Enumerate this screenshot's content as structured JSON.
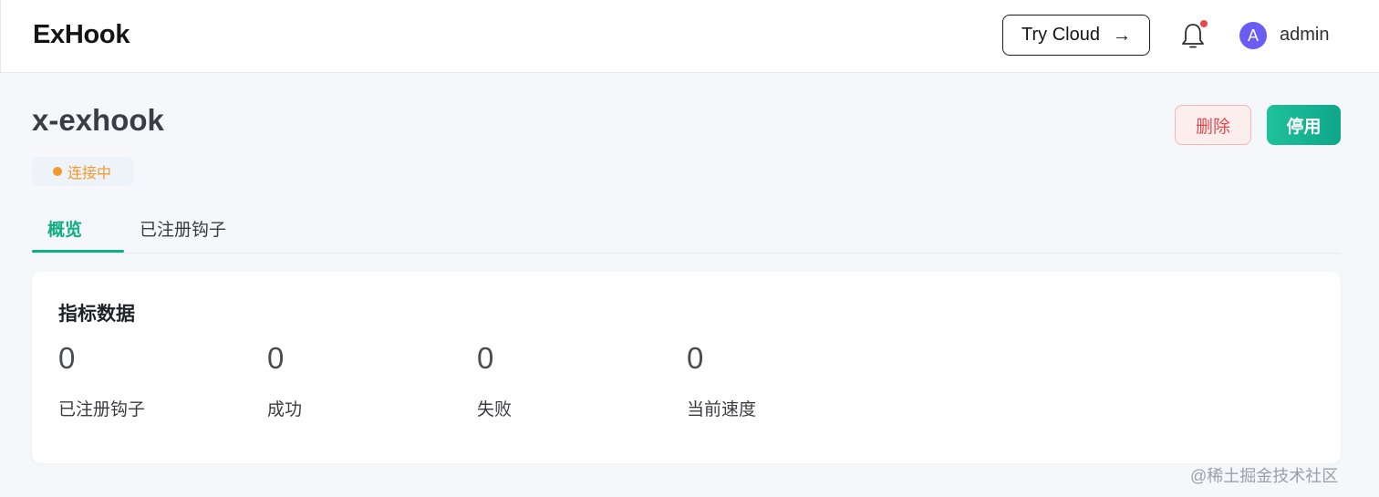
{
  "app": {
    "brand": "ExHook"
  },
  "header": {
    "try_cloud_label": "Try Cloud",
    "try_cloud_arrow": "→",
    "avatar_initial": "A",
    "username": "admin",
    "notification_dot_color": "#e5484d"
  },
  "page": {
    "title": "x-exhook",
    "status": "连接中",
    "status_color": "#f29a2e",
    "actions": {
      "delete_label": "删除",
      "disable_label": "停用"
    }
  },
  "tabs": [
    {
      "label": "概览",
      "active": true
    },
    {
      "label": "已注册钩子",
      "active": false
    }
  ],
  "metrics_card": {
    "title": "指标数据",
    "metrics": [
      {
        "value": "0",
        "label": "已注册钩子"
      },
      {
        "value": "0",
        "label": "成功"
      },
      {
        "value": "0",
        "label": "失败"
      },
      {
        "value": "0",
        "label": "当前速度"
      }
    ]
  },
  "watermark": "@稀土掘金技术社区",
  "colors": {
    "accent": "#0fae83",
    "danger": "#e04a4f",
    "avatar_bg": "#6b5cf6"
  }
}
